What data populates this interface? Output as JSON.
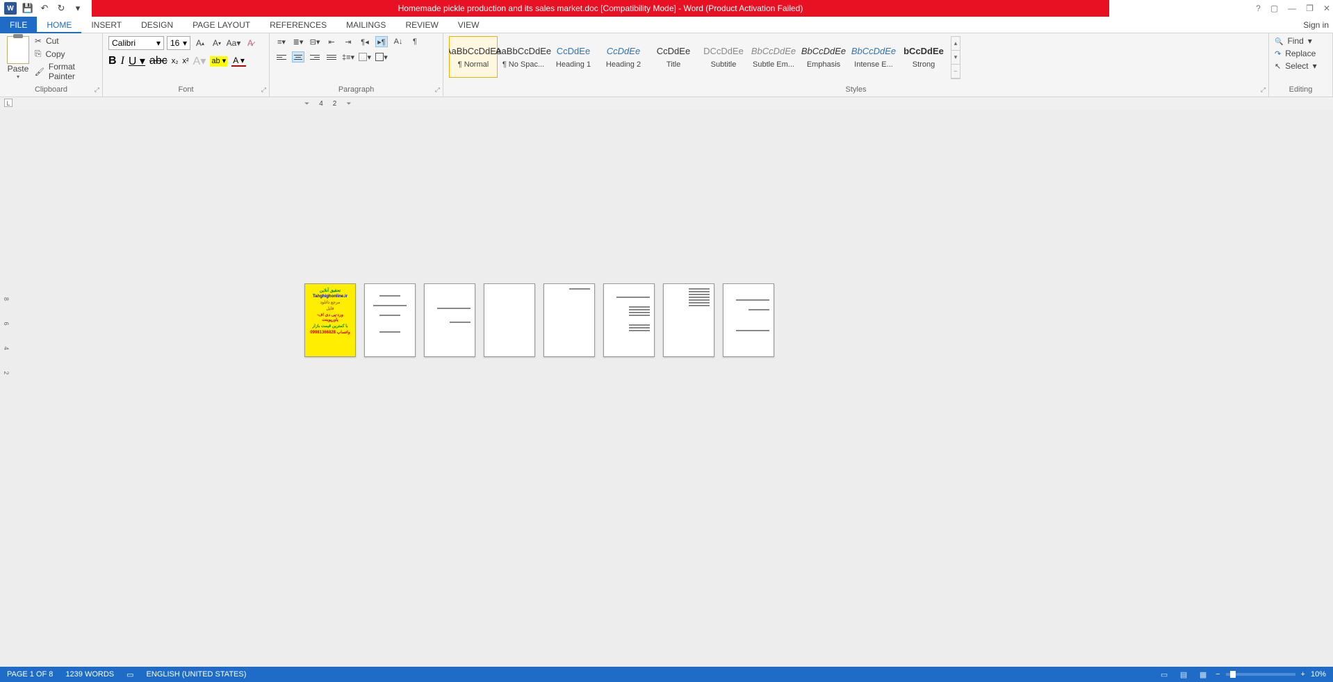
{
  "title": "Homemade pickle production and its sales market.doc [Compatibility Mode] -  Word (Product Activation Failed)",
  "qat": {
    "save": "💾",
    "undo": "↶",
    "redo": "↻"
  },
  "tabs": {
    "file": "FILE",
    "home": "HOME",
    "insert": "INSERT",
    "design": "DESIGN",
    "page_layout": "PAGE LAYOUT",
    "references": "REFERENCES",
    "mailings": "MAILINGS",
    "review": "REVIEW",
    "view": "VIEW"
  },
  "signin": "Sign in",
  "clipboard": {
    "paste": "Paste",
    "cut": "Cut",
    "copy": "Copy",
    "format_painter": "Format Painter",
    "label": "Clipboard"
  },
  "font": {
    "name": "Calibri",
    "size": "16",
    "label": "Font"
  },
  "paragraph": {
    "label": "Paragraph"
  },
  "styles_label": "Styles",
  "styles": [
    {
      "preview": "AaBbCcDdEe",
      "name": "¶ Normal",
      "cls": "",
      "active": true
    },
    {
      "preview": "AaBbCcDdEe",
      "name": "¶ No Spac...",
      "cls": ""
    },
    {
      "preview": "CcDdEe",
      "name": "Heading 1",
      "cls": "blue"
    },
    {
      "preview": "CcDdEe",
      "name": "Heading 2",
      "cls": "blue ital"
    },
    {
      "preview": "CcDdEe",
      "name": "Title",
      "cls": ""
    },
    {
      "preview": "DCcDdEe",
      "name": "Subtitle",
      "cls": "gray"
    },
    {
      "preview": "BbCcDdEe",
      "name": "Subtle Em...",
      "cls": "gray ital"
    },
    {
      "preview": "BbCcDdEe",
      "name": "Emphasis",
      "cls": "ital"
    },
    {
      "preview": "BbCcDdEe",
      "name": "Intense E...",
      "cls": "blue ital"
    },
    {
      "preview": "bCcDdEe",
      "name": "Strong",
      "cls": "bold"
    }
  ],
  "editing": {
    "find": "Find",
    "replace": "Replace",
    "select": "Select",
    "label": "Editing"
  },
  "ruler": {
    "mark1": "4",
    "mark2": "2"
  },
  "vruler": "8  6  4  2",
  "status": {
    "page": "PAGE 1 OF 8",
    "words": "1239 WORDS",
    "lang": "ENGLISH (UNITED STATES)",
    "zoom": "10%"
  },
  "cover": {
    "l1": "تحقیق آنلاین",
    "l2": "Tahghighonline.ir",
    "l3": "مرجع دانلود",
    "l4": "فایل",
    "l5": "ورد-پی دی اف-پاورپوینت",
    "l6": "با کمترین قیمت بازار",
    "l7": "واتساپ 09981366828"
  }
}
